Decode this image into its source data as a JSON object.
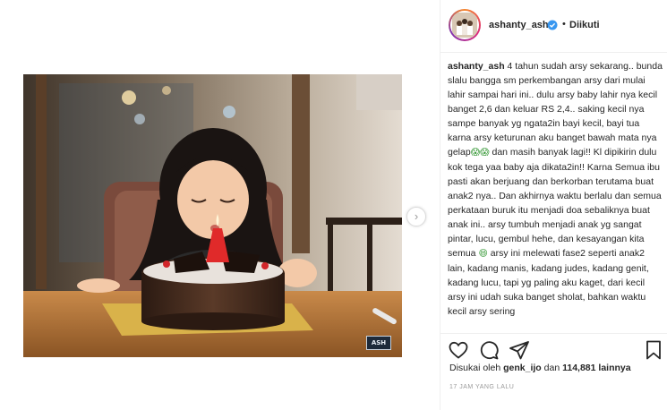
{
  "post": {
    "username": "ashanty_ash",
    "separator": "•",
    "follow_label": "Diikuti",
    "watermark": "ASH",
    "caption_username": "ashanty_ash",
    "caption_part1": " 4 tahun sudah arsy sekarang.. bunda slalu bangga sm perkembangan arsy dari mulai lahir sampai hari ini.. dulu arsy baby lahir nya kecil banget 2,6 dan keluar RS 2,4.. saking kecil nya sampe banyak yg ngata2in bayi kecil, bayi tua karna arsy keturunan aku banget bawah mata nya gelap",
    "caption_emoji1": "😱😱",
    "caption_part2": " dan masih banyak lagi!! Kl dipikirin dulu kok tega yaa baby aja dikata2in!! Karna Semua ibu pasti akan berjuang dan berkorban terutama buat anak2 nya.. Dan akhirnya waktu berlalu dan semua perkataan buruk itu menjadi doa sebaliknya buat anak ini.. arsy tumbuh menjadi anak yg sangat pintar, lucu, gembul hehe, dan kesayangan kita semua ",
    "caption_emoji2": "😄",
    "caption_part3": " arsy ini melewati fase2 seperti anak2 lain, kadang manis, kadang judes, kadang genit, kadang lucu, tapi yg paling aku kaget, dari kecil arsy ini udah suka banget sholat, bahkan waktu kecil arsy sering",
    "likes_prefix": "Disukai oleh",
    "liked_by": "genk_ijo",
    "likes_middle": "dan",
    "likes_count": "114,881",
    "likes_suffix": "lainnya",
    "timestamp": "17 JAM YANG LALU"
  },
  "icons": {
    "verified": "verified-badge-icon",
    "like": "heart-icon",
    "comment": "comment-icon",
    "share": "share-icon",
    "save": "bookmark-icon",
    "next": "chevron-right-icon"
  },
  "colors": {
    "verified": "#3897f0",
    "text": "#262626",
    "muted": "#999999",
    "border": "#efefef"
  }
}
